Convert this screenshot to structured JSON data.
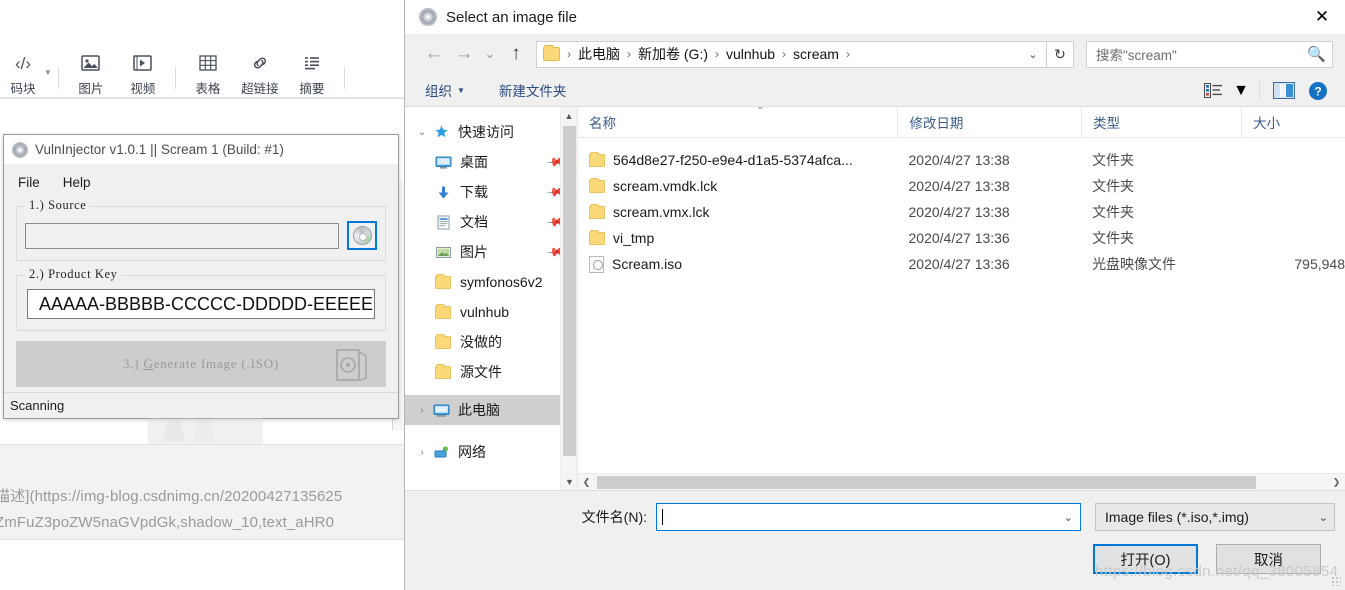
{
  "background_editor": {
    "ribbon": {
      "partial_left_label": "码块",
      "items": [
        {
          "label": "图片",
          "icon": "image-icon"
        },
        {
          "label": "视频",
          "icon": "video-icon"
        },
        {
          "label": "表格",
          "icon": "table-icon"
        },
        {
          "label": "超链接",
          "icon": "link-icon"
        },
        {
          "label": "摘要",
          "icon": "summary-icon"
        }
      ]
    },
    "markdown_text": {
      "line1": "描述](https://img-blog.csdnimg.cn/20200427135625",
      "line2": "ZmFuZ3poZW5naGVpdGk,shadow_10,text_aHR0"
    }
  },
  "vuln_injector": {
    "title": "VulnInjector v1.0.1 || Scream 1 (Build: #1)",
    "menu": [
      "File",
      "Help"
    ],
    "source": {
      "legend": "1.) Source",
      "input_value": "",
      "browse_icon": "cd-disc-icon"
    },
    "product_key": {
      "legend": "2.) Product Key",
      "value": "AAAAA-BBBBB-CCCCC-DDDDD-EEEEE"
    },
    "generate": {
      "label_prefix": "3.) ",
      "label_underlined": "G",
      "label_suffix": "enerate Image (.ISO)"
    },
    "status": "Scanning"
  },
  "dialog": {
    "title": "Select an image file",
    "title_icon": "cd-disc-icon",
    "close_label": "✕",
    "nav": {
      "back_icon": "arrow-left-icon",
      "forward_icon": "arrow-right-icon",
      "recent_icon": "chevron-down-icon",
      "up_icon": "arrow-up-icon",
      "breadcrumbs": [
        "此电脑",
        "新加卷 (G:)",
        "vulnhub",
        "scream"
      ],
      "address_caret": "⌄",
      "refresh_icon": "refresh-icon"
    },
    "search": {
      "placeholder": "搜索\"scream\"",
      "icon": "search-icon"
    },
    "command_bar": {
      "organize": "组织",
      "new_folder": "新建文件夹",
      "view_icon": "view-list-icon",
      "view_caret": "▼",
      "preview_icon": "preview-pane-icon",
      "help_icon": "help-icon"
    },
    "nav_pane": {
      "groups": [
        {
          "label": "快速访问",
          "icon": "pin-star-icon",
          "expander": "⌄",
          "selected": false,
          "pinned": false,
          "indent": 0
        },
        {
          "label": "桌面",
          "icon": "desktop-icon",
          "expander": "",
          "selected": false,
          "pinned": true,
          "indent": 1
        },
        {
          "label": "下载",
          "icon": "download-icon",
          "expander": "",
          "selected": false,
          "pinned": true,
          "indent": 1
        },
        {
          "label": "文档",
          "icon": "documents-icon",
          "expander": "",
          "selected": false,
          "pinned": true,
          "indent": 1
        },
        {
          "label": "图片",
          "icon": "pictures-icon",
          "expander": "",
          "selected": false,
          "pinned": true,
          "indent": 1
        },
        {
          "label": "symfonos6v2",
          "icon": "folder-icon",
          "expander": "",
          "selected": false,
          "pinned": false,
          "indent": 1
        },
        {
          "label": "vulnhub",
          "icon": "folder-icon",
          "expander": "",
          "selected": false,
          "pinned": false,
          "indent": 1
        },
        {
          "label": "没做的",
          "icon": "folder-icon",
          "expander": "",
          "selected": false,
          "pinned": false,
          "indent": 1
        },
        {
          "label": "源文件",
          "icon": "folder-icon",
          "expander": "",
          "selected": false,
          "pinned": false,
          "indent": 1
        },
        {
          "label": "此电脑",
          "icon": "computer-icon",
          "expander": "›",
          "selected": true,
          "pinned": false,
          "indent": 0
        },
        {
          "label": "网络",
          "icon": "network-icon",
          "expander": "›",
          "selected": false,
          "pinned": false,
          "indent": 0
        }
      ]
    },
    "file_list": {
      "columns": [
        "名称",
        "修改日期",
        "类型",
        "大小"
      ],
      "sort_indicator": "⌃",
      "rows": [
        {
          "name": "564d8e27-f250-e9e4-d1a5-5374afca...",
          "date": "2020/4/27 13:38",
          "type": "文件夹",
          "size": "",
          "icon": "folder-icon"
        },
        {
          "name": "scream.vmdk.lck",
          "date": "2020/4/27 13:38",
          "type": "文件夹",
          "size": "",
          "icon": "folder-icon"
        },
        {
          "name": "scream.vmx.lck",
          "date": "2020/4/27 13:38",
          "type": "文件夹",
          "size": "",
          "icon": "folder-icon"
        },
        {
          "name": "vi_tmp",
          "date": "2020/4/27 13:36",
          "type": "文件夹",
          "size": "",
          "icon": "folder-icon"
        },
        {
          "name": "Scream.iso",
          "date": "2020/4/27 13:36",
          "type": "光盘映像文件",
          "size": "795,948",
          "icon": "iso-file-icon"
        }
      ]
    },
    "footer": {
      "filename_label": "文件名(N):",
      "filename_value": "",
      "filename_caret": "⌄",
      "filter_value": "Image files (*.iso,*.img)",
      "filter_caret": "⌄",
      "open_button": "打开(O)",
      "cancel_button": "取消"
    },
    "watermark": "https://blog.csdn.net/qq_38005854"
  }
}
